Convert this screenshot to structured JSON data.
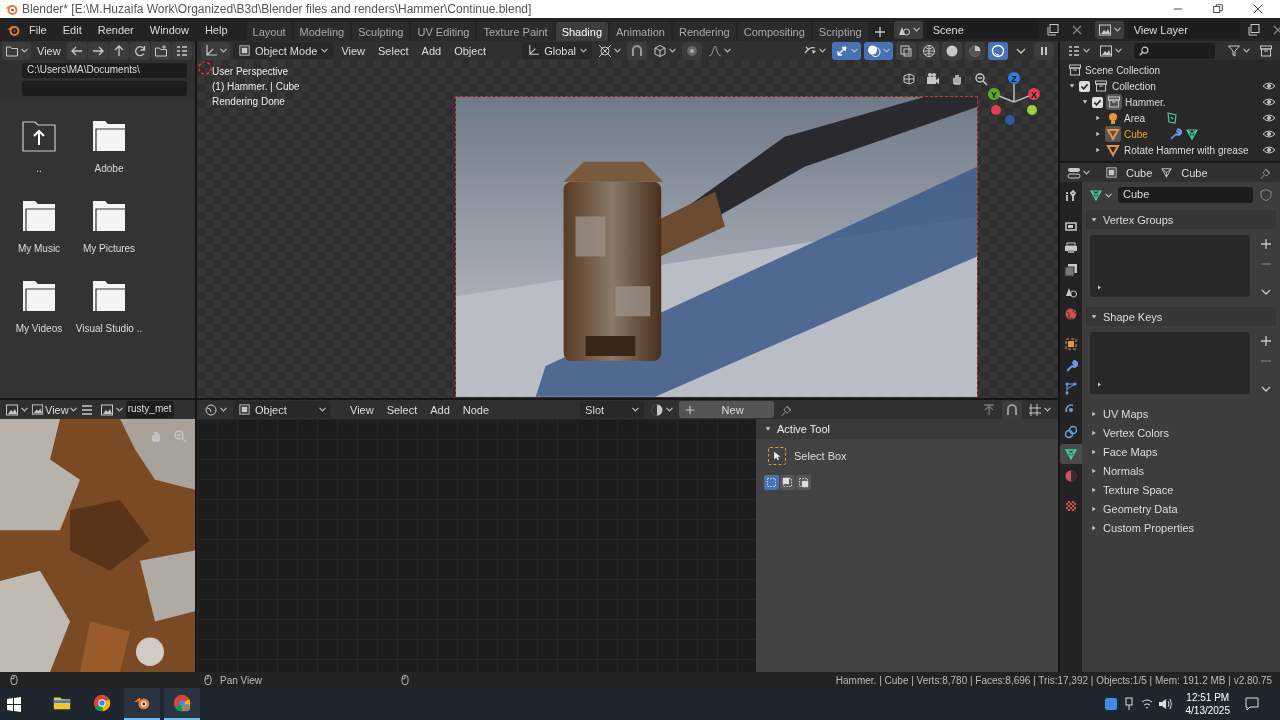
{
  "window": {
    "title": "Blender* [E:\\M.Huzaifa Work\\Organized\\B3d\\Blender files and renders\\Hammer\\Continue.blend]"
  },
  "menu": [
    "File",
    "Edit",
    "Render",
    "Window",
    "Help"
  ],
  "workspaces": [
    {
      "label": "Layout",
      "selected": false
    },
    {
      "label": "Modeling",
      "selected": false
    },
    {
      "label": "Sculpting",
      "selected": false
    },
    {
      "label": "UV Editing",
      "selected": false
    },
    {
      "label": "Texture Paint",
      "selected": false
    },
    {
      "label": "Shading",
      "selected": true
    },
    {
      "label": "Animation",
      "selected": false
    },
    {
      "label": "Rendering",
      "selected": false
    },
    {
      "label": "Compositing",
      "selected": false
    },
    {
      "label": "Scripting",
      "selected": false
    }
  ],
  "scene": {
    "name": "Scene"
  },
  "view_layer": {
    "name": "View Layer"
  },
  "file_browser": {
    "menu": "View",
    "path": "C:\\Users\\MA\\Documents\\",
    "items": [
      {
        "name": "..",
        "kind": "parent"
      },
      {
        "name": "Adobe",
        "kind": "folder"
      },
      {
        "name": "My Music",
        "kind": "folder"
      },
      {
        "name": "My Pictures",
        "kind": "folder"
      },
      {
        "name": "My Videos",
        "kind": "folder"
      },
      {
        "name": "Visual Studio ..",
        "kind": "folder"
      }
    ]
  },
  "viewport": {
    "mode": "Object Mode",
    "menus": [
      "View",
      "Select",
      "Add",
      "Object"
    ],
    "orientation": "Global",
    "toggles": [
      {
        "kind": "gizmo",
        "on": true
      },
      {
        "kind": "overlay",
        "on": true
      },
      {
        "kind": "xray",
        "on": false
      }
    ],
    "shading": [
      {
        "kind": "wireframe",
        "selected": false
      },
      {
        "kind": "solid",
        "selected": false
      },
      {
        "kind": "material",
        "selected": false
      },
      {
        "kind": "rendered",
        "selected": true
      }
    ],
    "info": [
      "User Perspective",
      "(1) Hammer. | Cube",
      "Rendering Done"
    ],
    "gizmo_axes": [
      "Z",
      "Y",
      "X"
    ]
  },
  "outliner": {
    "root": "Scene Collection",
    "tree": [
      {
        "name": "Collection",
        "kind": "collection",
        "checked": true,
        "expanded": true,
        "selected": false,
        "children": [
          {
            "name": "Hammer.",
            "kind": "collection",
            "checked": true,
            "expanded": true,
            "selected": false,
            "children": [
              {
                "name": "Area",
                "kind": "light",
                "expanded": false,
                "selected": false
              },
              {
                "name": "Cube",
                "kind": "mesh",
                "modifier": true,
                "expanded": false,
                "selected": true
              },
              {
                "name": "Rotate Hammer with grease",
                "kind": "mesh",
                "expanded": false,
                "selected": false
              }
            ]
          }
        ]
      }
    ]
  },
  "properties": {
    "object": "Cube",
    "data": "Cube",
    "mesh_name": "Cube",
    "tabs": [
      {
        "kind": "tool",
        "selected": false
      },
      {
        "kind": "render",
        "selected": false
      },
      {
        "kind": "output",
        "selected": false
      },
      {
        "kind": "view_layer",
        "selected": false
      },
      {
        "kind": "scene",
        "selected": false
      },
      {
        "kind": "world",
        "selected": false
      },
      {
        "kind": "object",
        "selected": false
      },
      {
        "kind": "modifiers",
        "selected": false
      },
      {
        "kind": "particles",
        "selected": false
      },
      {
        "kind": "physics",
        "selected": false
      },
      {
        "kind": "constraints",
        "selected": false
      },
      {
        "kind": "data",
        "selected": true
      },
      {
        "kind": "material",
        "selected": false
      },
      {
        "kind": "texture",
        "selected": false
      }
    ],
    "panels": [
      {
        "title": "Vertex Groups",
        "expanded": true
      },
      {
        "title": "Shape Keys",
        "expanded": true
      },
      {
        "title": "UV Maps",
        "expanded": false
      },
      {
        "title": "Vertex Colors",
        "expanded": false
      },
      {
        "title": "Face Maps",
        "expanded": false
      },
      {
        "title": "Normals",
        "expanded": false
      },
      {
        "title": "Texture Space",
        "expanded": false
      },
      {
        "title": "Geometry Data",
        "expanded": false
      },
      {
        "title": "Custom Properties",
        "expanded": false
      }
    ]
  },
  "image_editor": {
    "menu": "View",
    "image": "rusty_met"
  },
  "node_editor": {
    "object_type": "Object",
    "menus": [
      "View",
      "Select",
      "Add",
      "Node"
    ],
    "slot": "Slot",
    "new_label": "New"
  },
  "sidebar": {
    "panel": "Active Tool",
    "tool": "Select Box",
    "modes": [
      {
        "selected": true
      },
      {
        "selected": false
      },
      {
        "selected": false
      }
    ]
  },
  "status_bar": {
    "hint": "Pan View",
    "stats": "Hammer. | Cube | Verts:8,780 | Faces:8,696 | Tris:17,392 | Objects:1/5 | Mem: 191.2 MB | v2.80.75"
  },
  "taskbar": {
    "apps": [
      {
        "kind": "explorer",
        "running": false
      },
      {
        "kind": "chrome",
        "running": false
      },
      {
        "kind": "blender",
        "running": true
      },
      {
        "kind": "chrome_profile",
        "running": true
      }
    ],
    "time": "12:51 PM",
    "date": "4/13/2025"
  }
}
